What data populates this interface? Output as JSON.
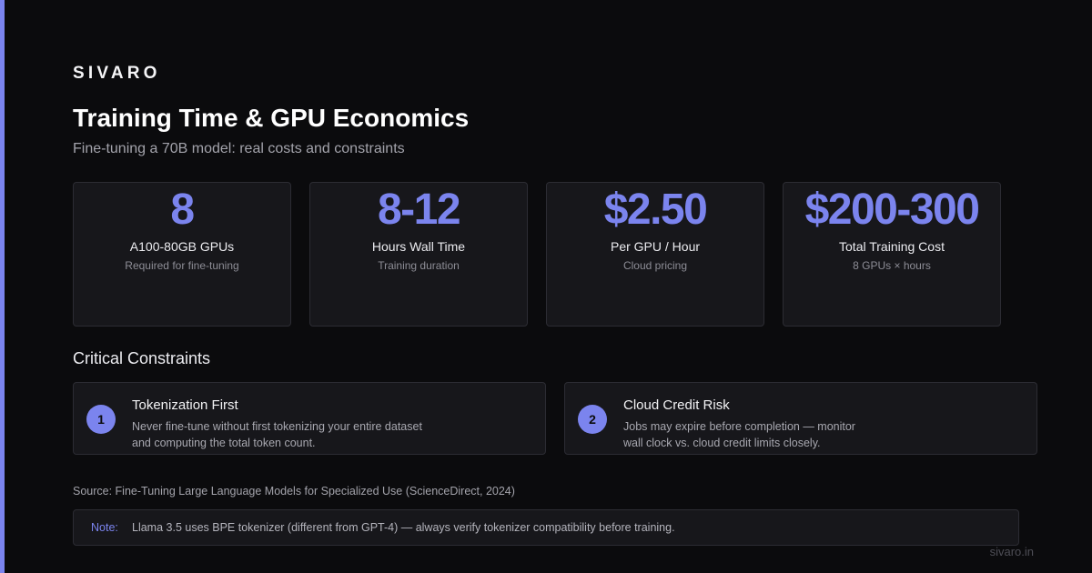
{
  "brand": "SIVARO",
  "title": "Training Time & GPU Economics",
  "subtitle": "Fine-tuning a 70B model: real costs and constraints",
  "stats": [
    {
      "value": "8",
      "label": "A100-80GB GPUs",
      "sub": "Required for fine-tuning"
    },
    {
      "value": "8-12",
      "label": "Hours Wall Time",
      "sub": "Training duration"
    },
    {
      "value": "$2.50",
      "label": "Per GPU / Hour",
      "sub": "Cloud pricing"
    },
    {
      "value": "$200-300",
      "label": "Total Training Cost",
      "sub": "8 GPUs × hours"
    }
  ],
  "constraints_heading": "Critical Constraints",
  "constraints": [
    {
      "number": "1",
      "title": "Tokenization First",
      "desc_line1": "Never fine-tune without first tokenizing your entire dataset",
      "desc_line2": "and computing the total token count."
    },
    {
      "number": "2",
      "title": "Cloud Credit Risk",
      "desc_line1": "Jobs may expire before completion — monitor",
      "desc_line2": "wall clock vs. cloud credit limits closely."
    }
  ],
  "source": "Source: Fine-Tuning Large Language Models for Specialized Use (ScienceDirect, 2024)",
  "note": {
    "label": "Note:",
    "text": "Llama 3.5 uses BPE tokenizer (different from GPT-4) — always verify tokenizer compatibility before training."
  },
  "footer_url": "sivaro.in",
  "colors": {
    "accent": "#7b84ee",
    "background": "#0b0b0d",
    "card": "#17171b",
    "card_border": "#2c2c33"
  }
}
